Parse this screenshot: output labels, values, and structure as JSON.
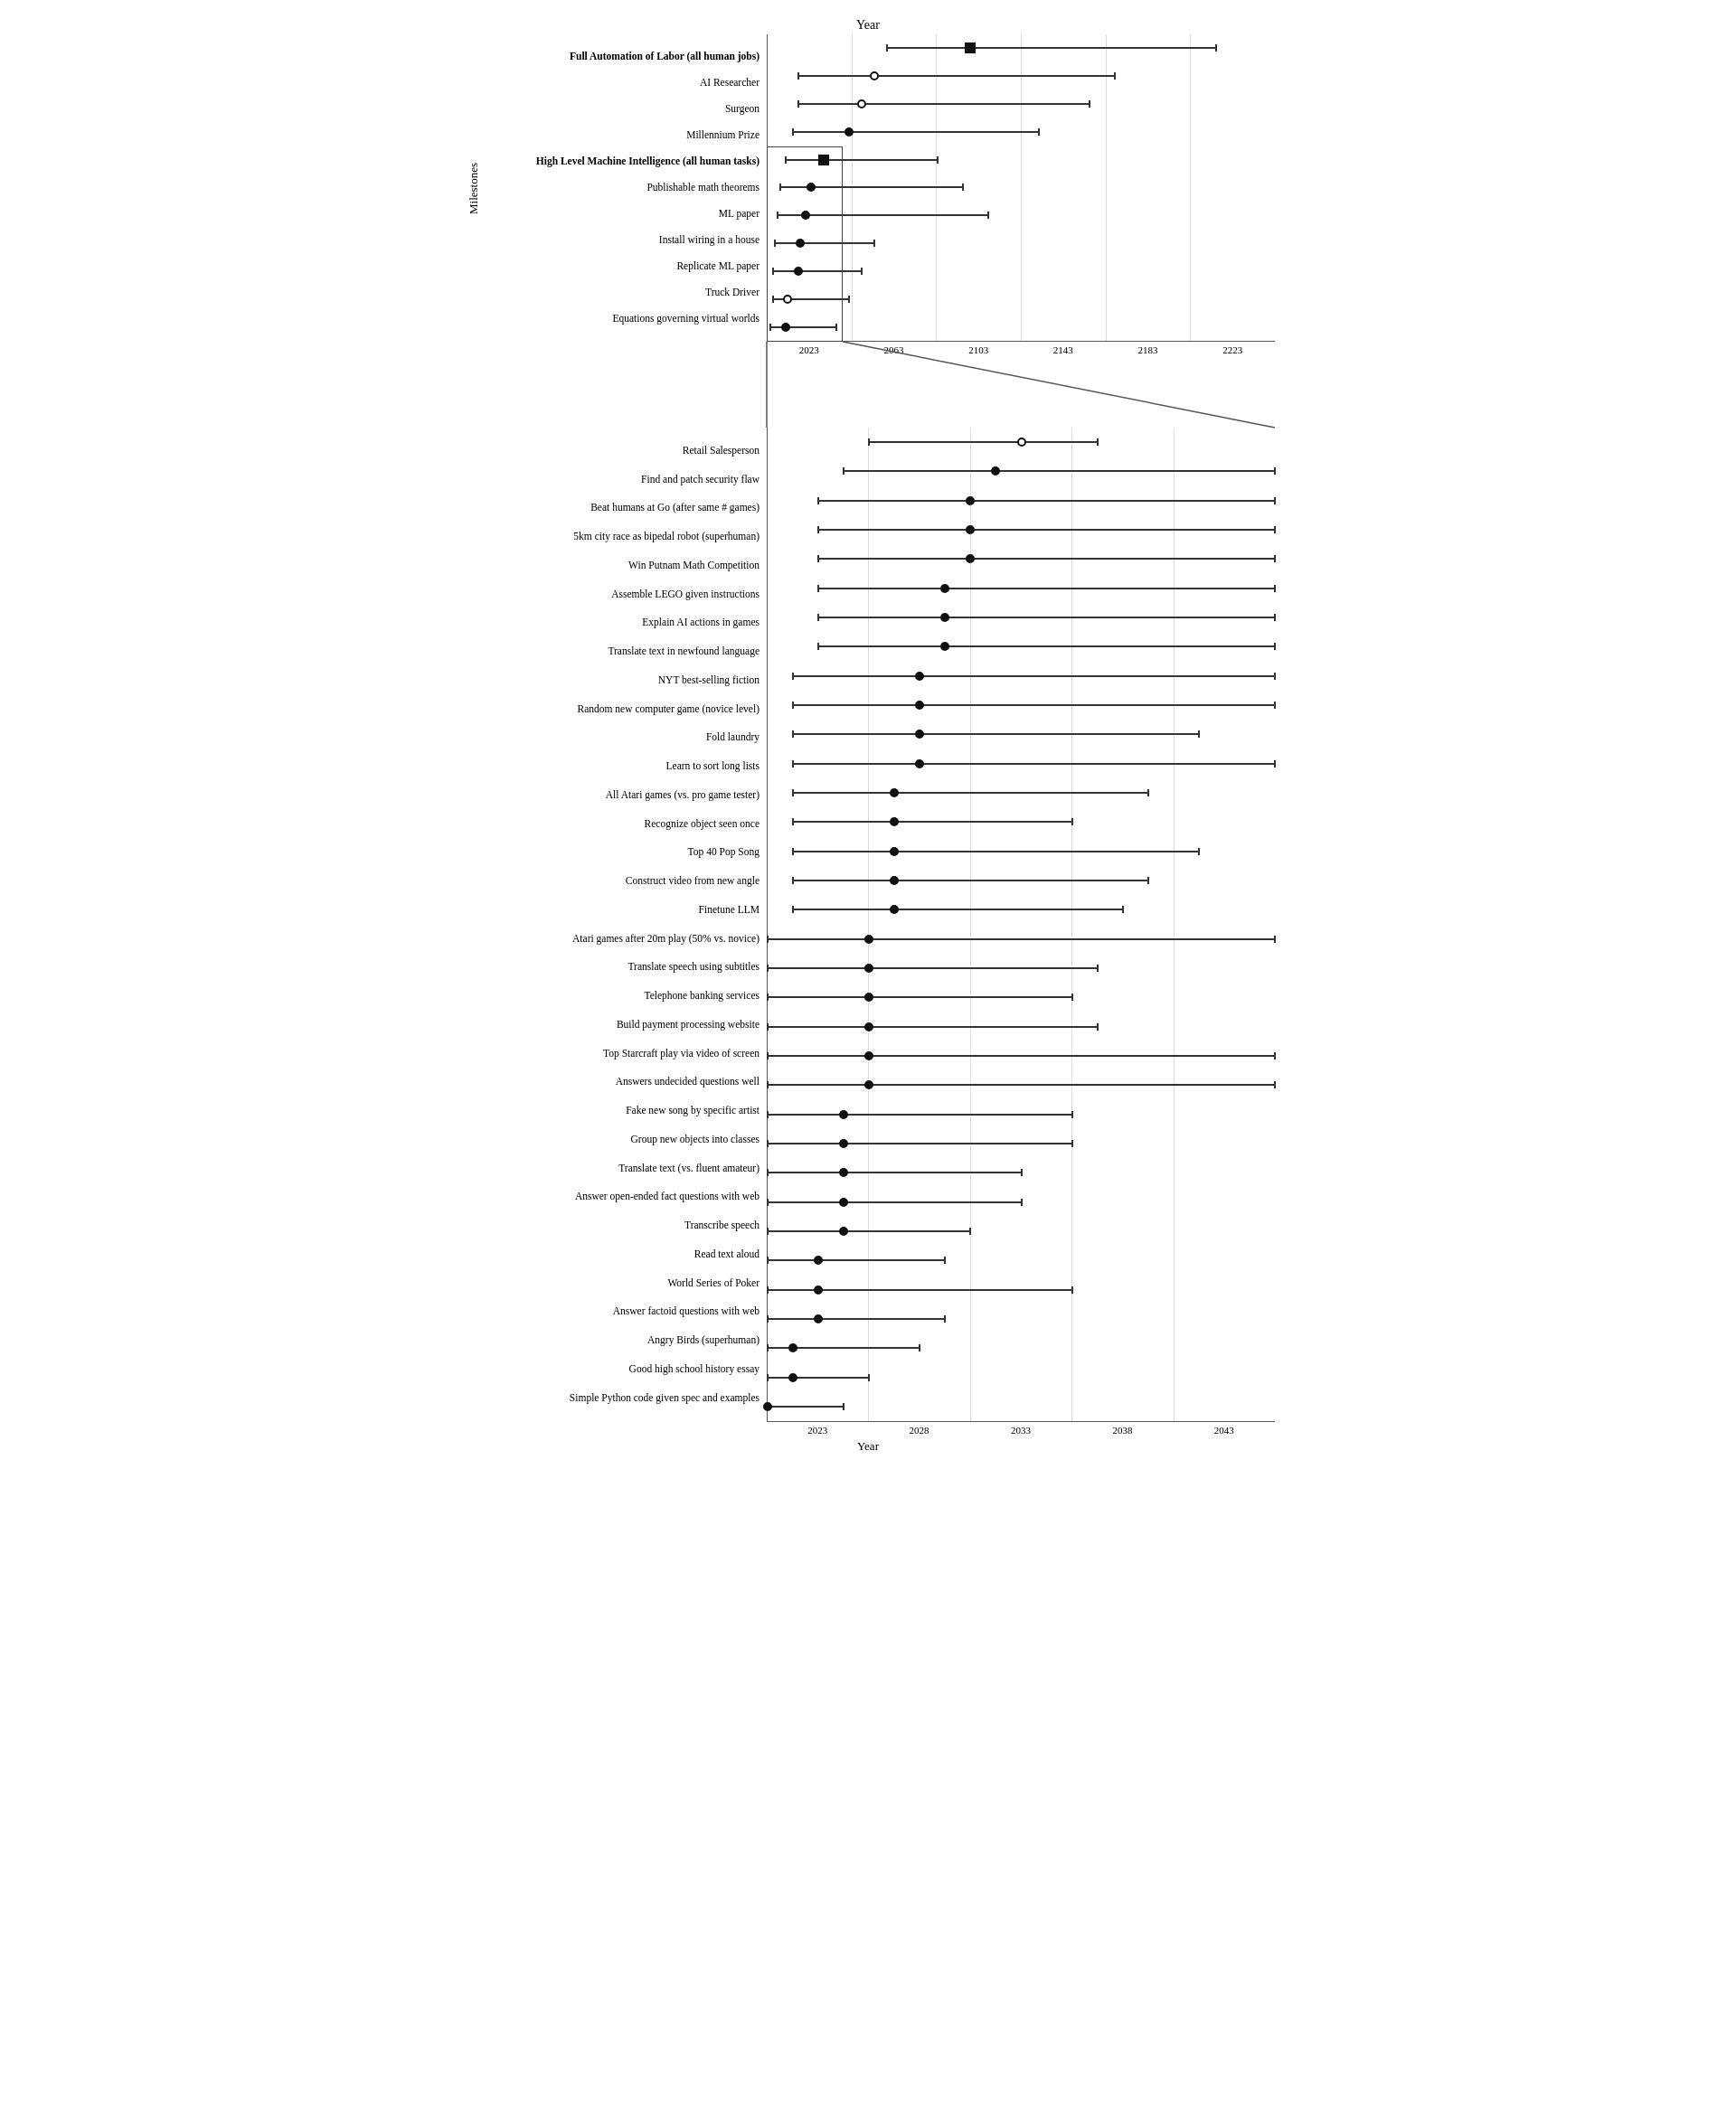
{
  "top_chart": {
    "title": "Year",
    "x_axis": {
      "labels": [
        "2023",
        "2063",
        "2103",
        "2143",
        "2183",
        "2223"
      ],
      "min": 2023,
      "max": 2223,
      "title": ""
    },
    "y_axis_label": "Milestones",
    "rows": [
      {
        "label": "Full Automation of Labor (all human jobs)",
        "bold": true,
        "median": 2103,
        "low": 2070,
        "high": 2200,
        "open": false,
        "square": true
      },
      {
        "label": "AI Researcher",
        "bold": false,
        "median": 2065,
        "low": 2035,
        "high": 2160,
        "open": true,
        "square": false
      },
      {
        "label": "Surgeon",
        "bold": false,
        "median": 2060,
        "low": 2035,
        "high": 2150,
        "open": true,
        "square": false
      },
      {
        "label": "Millennium Prize",
        "bold": false,
        "median": 2055,
        "low": 2033,
        "high": 2130,
        "open": false,
        "square": false
      },
      {
        "label": "High Level Machine Intelligence (all human tasks)",
        "bold": true,
        "median": 2045,
        "low": 2030,
        "high": 2090,
        "open": false,
        "square": true
      },
      {
        "label": "Publishable math theorems",
        "bold": false,
        "median": 2040,
        "low": 2028,
        "high": 2100,
        "open": false,
        "square": false
      },
      {
        "label": "ML paper",
        "bold": false,
        "median": 2038,
        "low": 2027,
        "high": 2110,
        "open": false,
        "square": false
      },
      {
        "label": "Install wiring in a house",
        "bold": false,
        "median": 2036,
        "low": 2026,
        "high": 2065,
        "open": false,
        "square": false
      },
      {
        "label": "Replicate ML paper",
        "bold": false,
        "median": 2035,
        "low": 2025,
        "high": 2060,
        "open": false,
        "square": false
      },
      {
        "label": "Truck Driver",
        "bold": false,
        "median": 2031,
        "low": 2025,
        "high": 2055,
        "open": true,
        "square": false
      },
      {
        "label": "Equations governing virtual worlds",
        "bold": false,
        "median": 2030,
        "low": 2024,
        "high": 2050,
        "open": false,
        "square": false
      }
    ],
    "zoom_rows": [
      4,
      10
    ],
    "zoom_row_labels": [
      "High Level Machine Intelligence (all human tasks)",
      "Equations governing virtual worlds"
    ]
  },
  "bottom_chart": {
    "title": "Year",
    "x_axis": {
      "labels": [
        "2023",
        "2028",
        "2033",
        "2038",
        "2043"
      ],
      "min": 2023,
      "max": 2043,
      "title": "Year"
    },
    "y_axis_label": "",
    "rows": [
      {
        "label": "Retail Salesperson",
        "median": 2033,
        "low": 2027,
        "high": 2036,
        "open": true,
        "square": false
      },
      {
        "label": "Find and patch security flaw",
        "median": 2032,
        "low": 2026,
        "high": 2043,
        "open": false,
        "square": false
      },
      {
        "label": "Beat humans at Go (after same # games)",
        "median": 2031,
        "low": 2025,
        "high": 2043,
        "open": false,
        "square": false
      },
      {
        "label": "5km city race as bipedal robot (superhuman)",
        "median": 2031,
        "low": 2025,
        "high": 2043,
        "open": false,
        "square": false
      },
      {
        "label": "Win Putnam Math Competition",
        "median": 2031,
        "low": 2025,
        "high": 2043,
        "open": false,
        "square": false
      },
      {
        "label": "Assemble LEGO given instructions",
        "median": 2030,
        "low": 2025,
        "high": 2043,
        "open": false,
        "square": false
      },
      {
        "label": "Explain AI actions in games",
        "median": 2030,
        "low": 2025,
        "high": 2043,
        "open": false,
        "square": false
      },
      {
        "label": "Translate text in newfound language",
        "median": 2030,
        "low": 2025,
        "high": 2043,
        "open": false,
        "square": false
      },
      {
        "label": "NYT best-selling fiction",
        "median": 2029,
        "low": 2024,
        "high": 2043,
        "open": false,
        "square": false
      },
      {
        "label": "Random new computer game (novice level)",
        "median": 2029,
        "low": 2024,
        "high": 2043,
        "open": false,
        "square": false
      },
      {
        "label": "Fold laundry",
        "median": 2029,
        "low": 2024,
        "high": 2040,
        "open": false,
        "square": false
      },
      {
        "label": "Learn to sort long lists",
        "median": 2029,
        "low": 2024,
        "high": 2043,
        "open": false,
        "square": false
      },
      {
        "label": "All Atari games (vs. pro game tester)",
        "median": 2028,
        "low": 2024,
        "high": 2038,
        "open": false,
        "square": false
      },
      {
        "label": "Recognize object seen once",
        "median": 2028,
        "low": 2024,
        "high": 2035,
        "open": false,
        "square": false
      },
      {
        "label": "Top 40 Pop Song",
        "median": 2028,
        "low": 2024,
        "high": 2040,
        "open": false,
        "square": false
      },
      {
        "label": "Construct video from new angle",
        "median": 2028,
        "low": 2024,
        "high": 2038,
        "open": false,
        "square": false
      },
      {
        "label": "Finetune LLM",
        "median": 2028,
        "low": 2024,
        "high": 2037,
        "open": false,
        "square": false
      },
      {
        "label": "Atari games after 20m play (50% vs. novice)",
        "median": 2027,
        "low": 2023,
        "high": 2043,
        "open": false,
        "square": false
      },
      {
        "label": "Translate speech using subtitles",
        "median": 2027,
        "low": 2023,
        "high": 2036,
        "open": false,
        "square": false
      },
      {
        "label": "Telephone banking services",
        "median": 2027,
        "low": 2023,
        "high": 2035,
        "open": false,
        "square": false
      },
      {
        "label": "Build payment processing website",
        "median": 2027,
        "low": 2023,
        "high": 2036,
        "open": false,
        "square": false
      },
      {
        "label": "Top Starcraft play via video of screen",
        "median": 2027,
        "low": 2023,
        "high": 2043,
        "open": false,
        "square": false
      },
      {
        "label": "Answers undecided questions well",
        "median": 2027,
        "low": 2023,
        "high": 2043,
        "open": false,
        "square": false
      },
      {
        "label": "Fake new song by specific artist",
        "median": 2026,
        "low": 2023,
        "high": 2035,
        "open": false,
        "square": false
      },
      {
        "label": "Group new objects into classes",
        "median": 2026,
        "low": 2023,
        "high": 2035,
        "open": false,
        "square": false
      },
      {
        "label": "Translate text (vs. fluent amateur)",
        "median": 2026,
        "low": 2023,
        "high": 2033,
        "open": false,
        "square": false
      },
      {
        "label": "Answer open-ended fact questions with web",
        "median": 2026,
        "low": 2023,
        "high": 2033,
        "open": false,
        "square": false
      },
      {
        "label": "Transcribe speech",
        "median": 2026,
        "low": 2023,
        "high": 2031,
        "open": false,
        "square": false
      },
      {
        "label": "Read text aloud",
        "median": 2025,
        "low": 2023,
        "high": 2030,
        "open": false,
        "square": false
      },
      {
        "label": "World Series of Poker",
        "median": 2025,
        "low": 2023,
        "high": 2035,
        "open": false,
        "square": false
      },
      {
        "label": "Answer factoid questions with web",
        "median": 2025,
        "low": 2023,
        "high": 2030,
        "open": false,
        "square": false
      },
      {
        "label": "Angry Birds (superhuman)",
        "median": 2024,
        "low": 2023,
        "high": 2029,
        "open": false,
        "square": false
      },
      {
        "label": "Good high school history essay",
        "median": 2024,
        "low": 2023,
        "high": 2027,
        "open": false,
        "square": false
      },
      {
        "label": "Simple Python code given spec and examples",
        "median": 2023,
        "low": 2023,
        "high": 2026,
        "open": false,
        "square": false
      }
    ]
  }
}
